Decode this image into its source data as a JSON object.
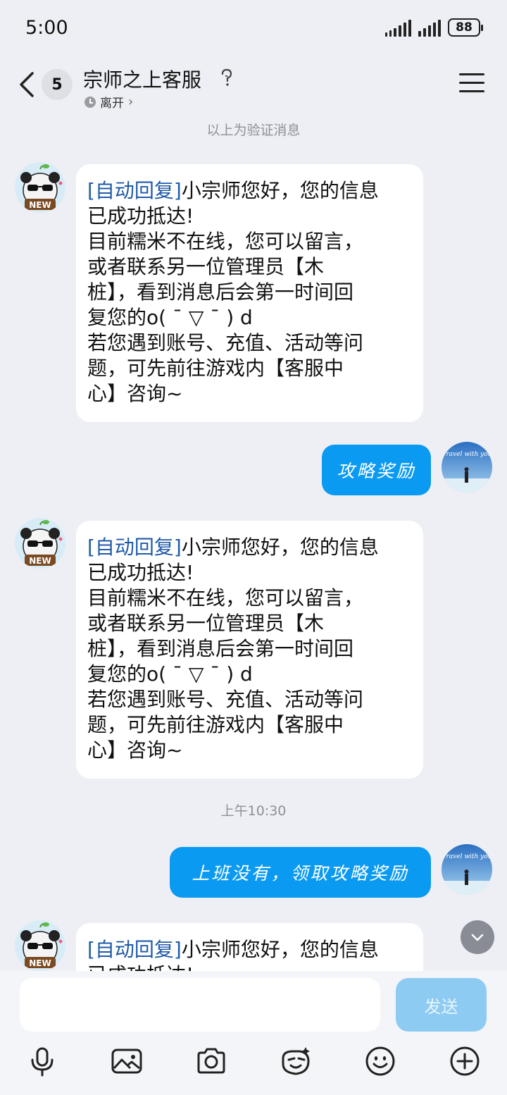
{
  "status_bar": {
    "time": "5:00",
    "battery": "88"
  },
  "header": {
    "unread_count": "5",
    "title": "宗师之上客服",
    "presence": "离开",
    "presence_chevron": "›"
  },
  "chat": {
    "verification_note": "以上为验证消息",
    "timestamp": "上午10:30",
    "messages": [
      {
        "direction": "incoming",
        "tag": "[自动回复]",
        "lines": [
          "小宗师您好，您的信息",
          "已成功抵达!",
          "目前糯米不在线，您可以留言，",
          "或者联系另一位管理员【木",
          "桩】，看到消息后会第一时间回",
          "复您的o( ˉ ▽ ˉ ) d",
          "若您遇到账号、充值、活动等问",
          "题，可先前往游戏内【客服中",
          "心】咨询~"
        ]
      },
      {
        "direction": "outgoing",
        "text": "攻略奖励"
      },
      {
        "direction": "incoming",
        "tag": "[自动回复]",
        "lines": [
          "小宗师您好，您的信息",
          "已成功抵达!",
          "目前糯米不在线，您可以留言，",
          "或者联系另一位管理员【木",
          "桩】，看到消息后会第一时间回",
          "复您的o( ˉ ▽ ˉ ) d",
          "若您遇到账号、充值、活动等问",
          "题，可先前往游戏内【客服中",
          "心】咨询~"
        ]
      },
      {
        "direction": "outgoing",
        "text": "上班没有，领取攻略奖励"
      },
      {
        "direction": "incoming",
        "tag": "[自动回复]",
        "lines": [
          "小宗师您好，您的信息",
          "已成功抵达!"
        ]
      }
    ]
  },
  "input": {
    "placeholder": "",
    "send_label": "发送"
  },
  "toolbar": {
    "icons": [
      "microphone-icon",
      "image-icon",
      "camera-icon",
      "sticker-icon",
      "emoji-icon",
      "plus-icon"
    ]
  },
  "avatars": {
    "self_text": "Travel with you",
    "cs_badge": "NEW"
  },
  "colors": {
    "accent": "#0a9af2",
    "background": "#eeeff4",
    "tag_blue": "#1f5aa8"
  }
}
